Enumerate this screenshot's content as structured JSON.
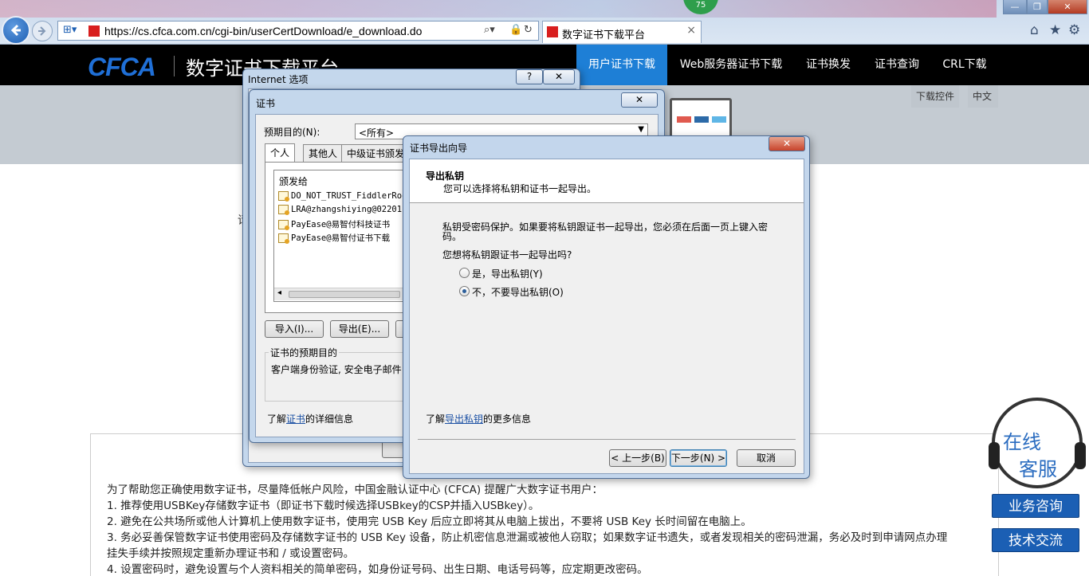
{
  "browser": {
    "address_url": "https://cs.cfca.com.cn/cgi-bin/userCertDownload/e_download.do",
    "tab_title": "数字证书下载平台",
    "badge": "75",
    "back_icon": "back-arrow-icon",
    "forward_icon": "forward-arrow-icon",
    "home_icon": "⌂",
    "favorites_icon": "★",
    "tools_icon": "⚙",
    "minimize": "—",
    "restore": "❐",
    "close": "✕"
  },
  "site": {
    "logo": "CFCA",
    "title": "数字证书下载平台",
    "nav": [
      "用户证书下载",
      "Web服务器证书下载",
      "证书换发",
      "证书查询",
      "CRL下载"
    ],
    "download_plugin": "下载控件",
    "language": "中文",
    "accent_color": "#1e7fd6"
  },
  "notice": {
    "intro": "为了帮助您正确使用数字证书，尽量降低帐户风险，中国金融认证中心 (CFCA) 提醒广大数字证书用户：",
    "items": [
      "1. 推荐使用USBKey存储数字证书（即证书下载时候选择USBkey的CSP并插入USBkey）。",
      "2. 避免在公共场所或他人计算机上使用数字证书，使用完 USB Key 后应立即将其从电脑上拔出，不要将 USB Key 长时间留在电脑上。",
      "3. 务必妥善保管数字证书使用密码及存储数字证书的 USB Key 设备，防止机密信息泄漏或被他人窃取；如果数字证书遗失，或者发现相关的密码泄漏，务必及时到申请网点办理",
      "挂失手续并按照规定重新办理证书和 / 或设置密码。",
      "4. 设置密码时，避免设置与个人资料相关的简单密码，如身份证号码、出生日期、电话号码等，应定期更改密码。"
    ],
    "side_char": "请"
  },
  "support": {
    "line1": "在线",
    "line2": "客服",
    "consult": "业务咨询",
    "tech": "技术交流"
  },
  "internet_options": {
    "title": "Internet 选项",
    "help": "?",
    "close": "✕"
  },
  "cert_dialog": {
    "title": "证书",
    "close": "✕",
    "purpose_label": "预期目的(N):",
    "purpose_value": "<所有>",
    "tabs": [
      "个人",
      "其他人",
      "中级证书颁发"
    ],
    "column_issued_to": "颁发给",
    "certs": [
      "DO_NOT_TRUST_FiddlerRoo",
      "LRA@zhangshiying@02201",
      "PayEase@易智付科技证书",
      "PayEase@易智付证书下载"
    ],
    "import_btn": "导入(I)...",
    "export_btn": "导出(E)...",
    "purposes_group": "证书的预期目的",
    "purposes_text": "客户端身份验证, 安全电子邮件",
    "learn_prefix": "了解",
    "learn_link": "证书",
    "learn_suffix": "的详细信息"
  },
  "wizard": {
    "title": "证书导出向导",
    "close": "✕",
    "heading": "导出私钥",
    "subheading": "您可以选择将私钥和证书一起导出。",
    "desc_line1": "私钥受密码保护。如果要将私钥跟证书一起导出，您必须在后面一页上键入密",
    "desc_line2": "码。",
    "question": "您想将私钥跟证书一起导出吗?",
    "option_yes": "是，导出私钥(Y)",
    "option_no": "不，不要导出私钥(O)",
    "selected_option": "no",
    "learn_prefix": "了解",
    "learn_link": "导出私钥",
    "learn_suffix": "的更多信息",
    "back_btn": "< 上一步(B)",
    "next_btn": "下一步(N) >",
    "cancel_btn": "取消"
  }
}
